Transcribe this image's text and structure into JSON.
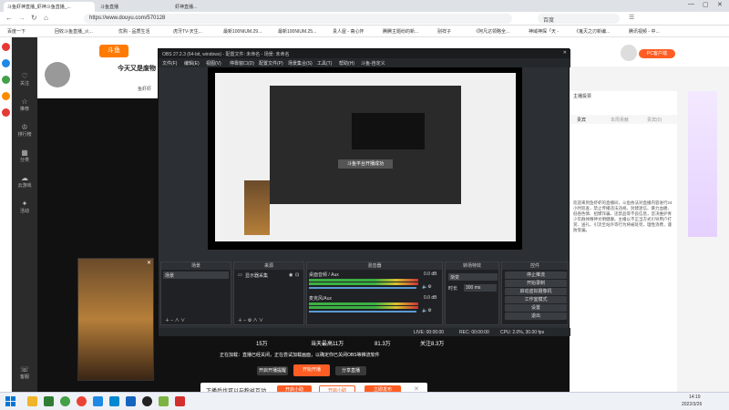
{
  "browser": {
    "tabs": [
      {
        "label": "斗鱼虾神直播_虾神斗鱼直播_..."
      },
      {
        "label": "斗鱼直播"
      },
      {
        "label": "虾神直播..."
      },
      {
        "label": "新标签"
      }
    ],
    "url": "https://www.douyu.com/570128",
    "search_engine": "百度",
    "bookmarks": [
      "百度一下",
      "回收斗鱼直播_火...",
      "优购 - 品质生活",
      "虎牙TV-天生...",
      "最新100NIUM.29...",
      "最新100NIUM.25...",
      "贵人屋 - 斋心怀",
      "腾腾主题纷的新...",
      "别祥子",
      "《阿凡达领略全...",
      "神域神探「天 -",
      "《鬼灭之刃新编...",
      "腾讯视频 - 中..."
    ]
  },
  "douyu": {
    "follow_count": "7",
    "followed_label": "主播已关注",
    "room_title": "今天又是废物",
    "streamer_name": "鱼虾虾",
    "left_nav": [
      "关注",
      "推荐",
      "排行榜",
      "分类",
      "云游戏",
      "活动",
      "客服"
    ],
    "right_tabs": [
      "贵宾",
      "本周贡献",
      "贵宾(0)"
    ],
    "right_label": "主播投票",
    "chat_notice": "欢迎来到鱼虾虾的直播间，斗鱼依法对直播内容进行24小时巡查，禁止传播违法违规、封建迷信、暴力血腥、低俗色情、招嫖诈骗、违禁品等不良信息，坚决维护青少年群体精神文明健康。主播以不正当方式引导用户打赏、送礼、引流至站外等行为将被处罚，理性消费，谨防受骗。",
    "pc_client_label": "PC客户端",
    "stats": [
      "15万",
      "当天最高11万",
      "81.3万",
      "关注8.3万"
    ],
    "stream_notice": "正在加载：直播已经关闭，正在尝试加载画面，以确定你已关闭OBS等推流软件",
    "buttons": {
      "follow": "开启开播提醒",
      "start": "开始开播",
      "share": "分享直播"
    },
    "bottom_banner": "下播后也可以与粉丝互动",
    "bottom_btn1": "开启小助",
    "bottom_btn2": "立即发布",
    "bottom_btn3": "开启小助"
  },
  "obs": {
    "title": "OBS 27.2.3 (64-bit, windows) - 配置文件: 未命名 - 场景: 未命名",
    "menu": [
      "文件(F)",
      "编辑(E)",
      "视图(V)",
      "停靠窗口(D)",
      "配置文件(P)",
      "场景集合(S)",
      "工具(T)",
      "帮助(H)",
      "斗鱼-自定义"
    ],
    "scenes_title": "场景",
    "scene_item": "场景",
    "sources_title": "来源",
    "source_item": "显示器采集",
    "mixer_title": "混音器",
    "mixer_tracks": [
      {
        "name": "桌面音频 / Aux",
        "db": "0.0 dB"
      },
      {
        "name": "麦克风/Aux",
        "db": "0.0 dB"
      }
    ],
    "transitions_title": "转场特效",
    "transition_type": "渐变",
    "duration_label": "时长",
    "duration_value": "300 ms",
    "controls_title": "控件",
    "controls": [
      "停止推流",
      "开始录制",
      "启动虚拟摄像机",
      "工作室模式",
      "设置",
      "退出"
    ],
    "preview_popup": "斗鱼平台开播成功",
    "status": {
      "live": "LIVE: 00:00:00",
      "rec": "REC: 00:00:00",
      "cpu": "CPU: 2.0%, 30.00 fps"
    }
  },
  "taskbar": {
    "time": "14:19",
    "date": "2022/3/26"
  }
}
